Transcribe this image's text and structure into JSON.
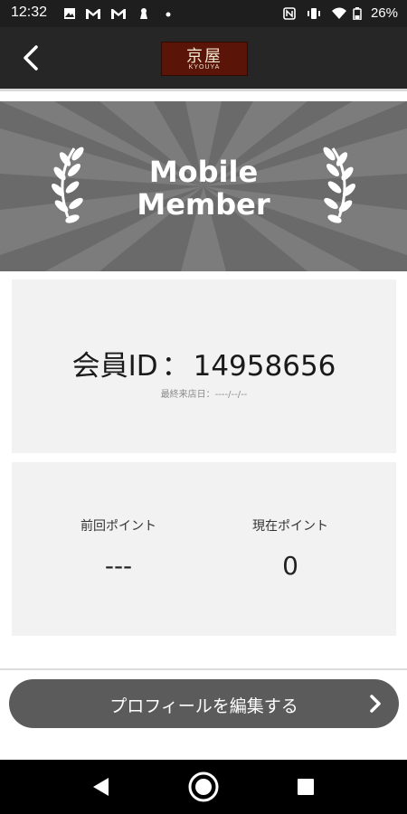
{
  "status_bar": {
    "time": "12:32",
    "battery": "26%",
    "left_icons": [
      "image-icon",
      "gmail-icon",
      "gmail-icon",
      "keyhole-icon",
      "dot-icon"
    ],
    "right_icons": [
      "nfc-icon",
      "vibrate-icon",
      "wifi-icon",
      "battery-icon"
    ]
  },
  "header": {
    "logo_kanji": "京屋",
    "logo_romaji": "KYOUYA"
  },
  "banner": {
    "title_line1": "Mobile",
    "title_line2": "Member"
  },
  "member": {
    "id_label": "会員ID",
    "id_separator": "：",
    "id_value": "14958656",
    "last_visit_label": "最終来店日：",
    "last_visit_value": "----/--/--"
  },
  "points": {
    "previous_label": "前回ポイント",
    "previous_value": "---",
    "current_label": "現在ポイント",
    "current_value": "0"
  },
  "edit_button": {
    "label": "プロフィールを編集する"
  },
  "colors": {
    "appbar": "#262626",
    "banner": "#6e6e6e",
    "card": "#f2f2f2",
    "button": "#5b5b5b",
    "logo": "#5a1508"
  }
}
